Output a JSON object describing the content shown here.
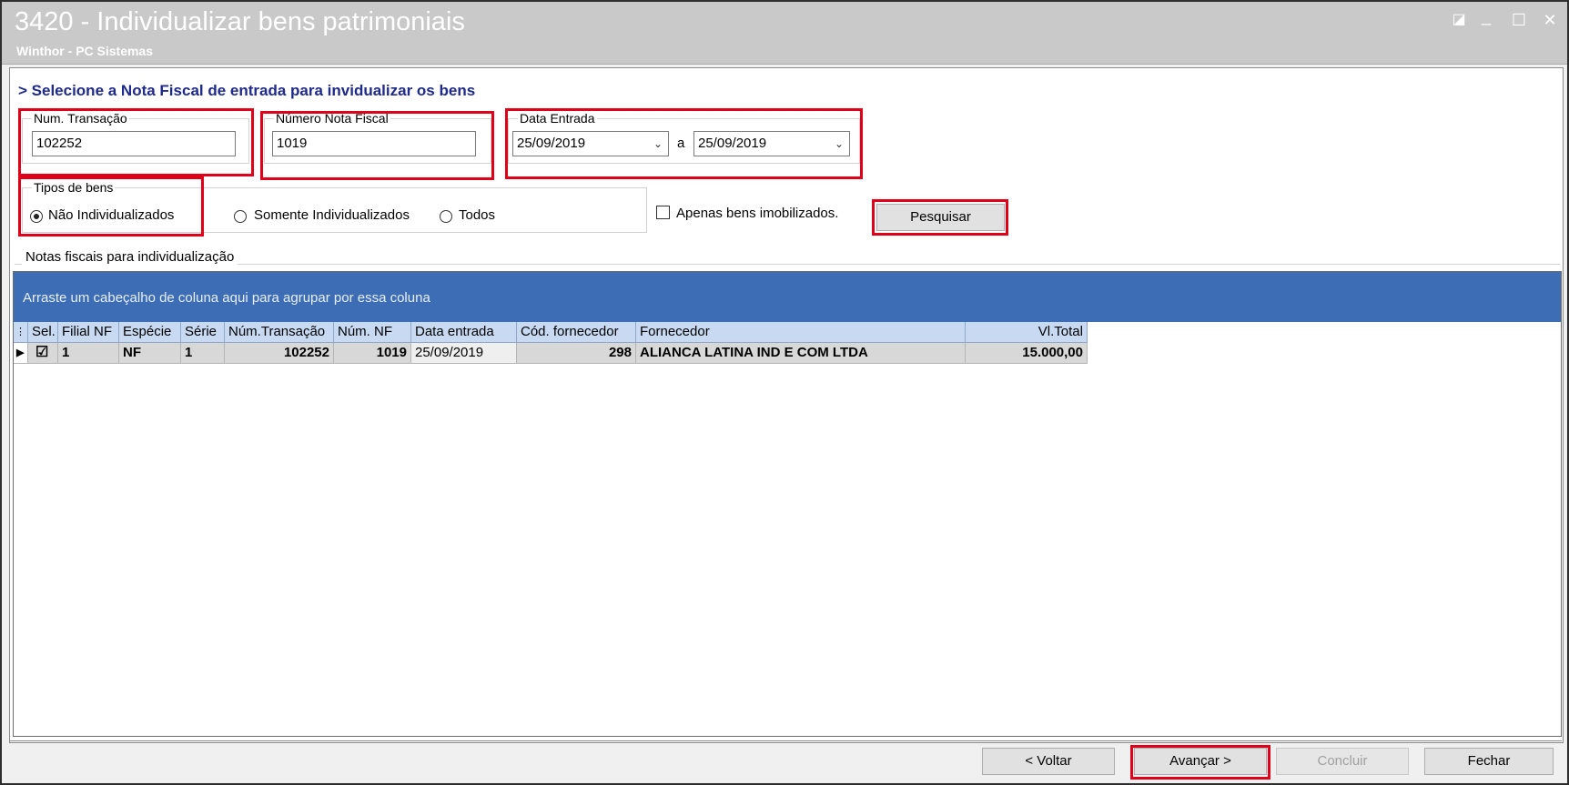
{
  "window": {
    "title": "3420 - Individualizar bens patrimoniais",
    "subtitle": "Winthor - PC Sistemas",
    "restore_glyph": "◪",
    "minimize_glyph": "_",
    "maximize_glyph": "☐",
    "close_glyph": "✕"
  },
  "heading": "> Selecione a Nota Fiscal de entrada para invidualizar os bens",
  "filters": {
    "num_transacao": {
      "label": "Num. Transação",
      "value": "102252"
    },
    "numero_nota_fiscal": {
      "label": "Número Nota Fiscal",
      "value": "1019"
    },
    "data_entrada": {
      "label": "Data Entrada",
      "from": "25/09/2019",
      "separator": "a",
      "to": "25/09/2019"
    },
    "tipos_de_bens": {
      "label": "Tipos de bens",
      "options": [
        "Não Individualizados",
        "Somente Individualizados",
        "Todos"
      ],
      "selected": "Não Individualizados"
    },
    "apenas_imobilizados": {
      "label": "Apenas bens imobilizados.",
      "checked": false
    },
    "search_button": "Pesquisar"
  },
  "grid": {
    "section_label": "Notas fiscais para individualização",
    "group_hint": "Arraste um cabeçalho de coluna aqui para agrupar por essa coluna",
    "columns": [
      "Sel.",
      "Filial NF",
      "Espécie",
      "Série",
      "Núm.Transação",
      "Núm. NF",
      "Data entrada",
      "Cód. fornecedor",
      "Fornecedor",
      "Vl.Total"
    ],
    "rows": [
      {
        "sel": true,
        "filial": "1",
        "especie": "NF",
        "serie": "1",
        "num_transacao": "102252",
        "num_nf": "1019",
        "data_entrada": "25/09/2019",
        "cod_fornecedor": "298",
        "fornecedor": "ALIANCA LATINA IND E COM LTDA",
        "vl_total": "15.000,00"
      }
    ]
  },
  "footer": {
    "voltar": "< Voltar",
    "avancar": "Avançar >",
    "concluir": "Concluir",
    "fechar": "Fechar"
  },
  "colors": {
    "highlight": "#e0001a",
    "heading": "#1e2a8c",
    "group_bar": "#3d6eb5",
    "header_row": "#c7daf2"
  }
}
